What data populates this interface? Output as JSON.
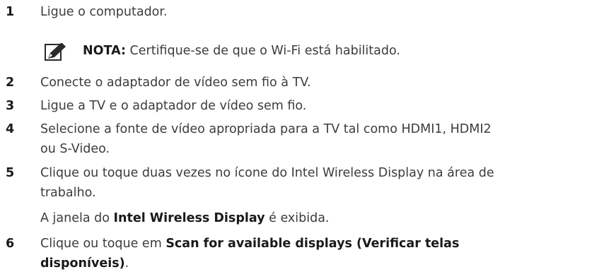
{
  "steps": [
    {
      "num": "1",
      "text": "Ligue o computador."
    },
    {
      "num": "2",
      "text": "Conecte o adaptador de vídeo sem fio à TV."
    },
    {
      "num": "3",
      "text": "Ligue a TV e o adaptador de vídeo sem fio."
    },
    {
      "num": "4",
      "line1": "Selecione a fonte de vídeo apropriada para a TV tal como HDMI1, HDMI2",
      "line2": "ou S-Video."
    },
    {
      "num": "5",
      "line1": "Clique ou toque duas vezes no ícone do Intel Wireless Display na área de",
      "line2": "trabalho.",
      "sub_pre": "A janela do ",
      "sub_bold": "Intel Wireless Display",
      "sub_post": " é exibida."
    },
    {
      "num": "6",
      "pre": "Clique ou toque em ",
      "bold1": "Scan for available displays (Verificar telas",
      "bold2": "disponíveis)",
      "post": "."
    }
  ],
  "note": {
    "icon": "pencil-note-icon",
    "label": "NOTA:",
    "text": " Certifique-se de que o Wi-Fi está habilitado."
  }
}
